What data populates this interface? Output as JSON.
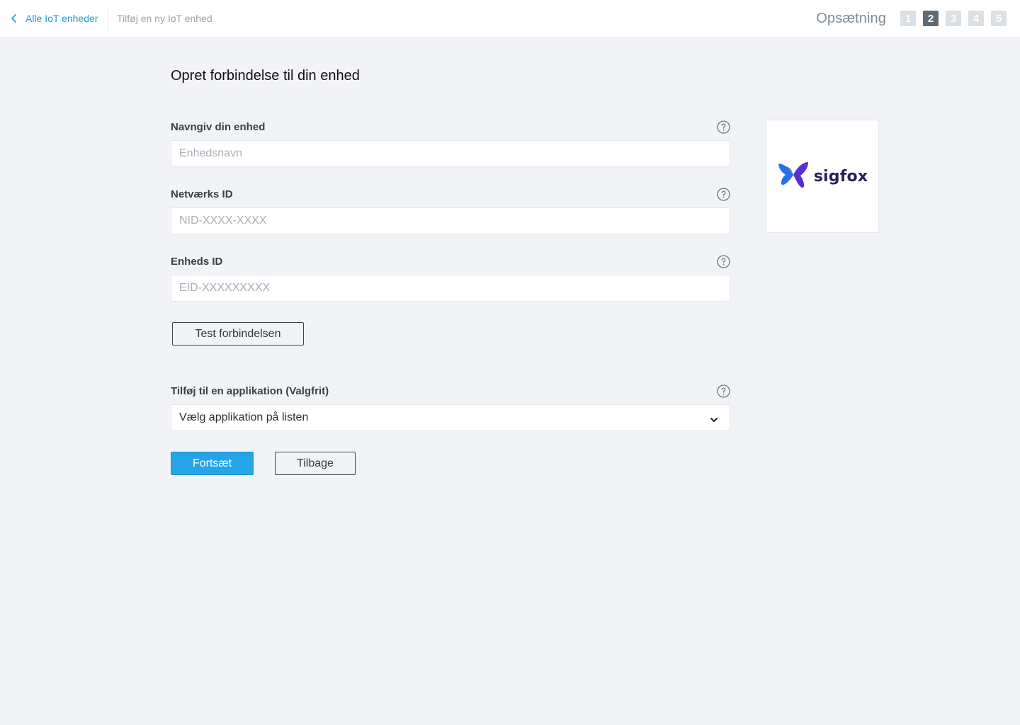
{
  "header": {
    "back_label": "Alle IoT enheder",
    "current_page": "Tilføj en ny IoT enhed",
    "steps_label": "Opsætning",
    "steps": [
      "1",
      "2",
      "3",
      "4",
      "5"
    ],
    "active_step": "2"
  },
  "main": {
    "title": "Opret forbindelse til din enhed",
    "fields": {
      "device_name": {
        "label": "Navngiv din enhed",
        "placeholder": "Enhedsnavn",
        "value": ""
      },
      "network_id": {
        "label": "Netværks ID",
        "placeholder": "NID-XXXX-XXXX",
        "value": ""
      },
      "device_id": {
        "label": "Enheds ID",
        "placeholder": "EID-XXXXXXXXX",
        "value": ""
      }
    },
    "test_button": "Test forbindelsen",
    "application": {
      "label": "Tilføj til en applikation (Valgfrit)",
      "selected": "Vælg applikation på listen"
    },
    "continue_button": "Fortsæt",
    "back_button": "Tilbage"
  },
  "provider": {
    "logo_text": "sigfox",
    "icon": "sigfox-butterfly-logo"
  },
  "colors": {
    "accent": "#26a4e6",
    "link": "#1f9bd8",
    "background": "#f1f3f7",
    "step_active": "#5e6b76",
    "step_inactive": "#dbe0e4",
    "logo_purple": "#5a2fd0",
    "logo_blue": "#2a6ef0",
    "logo_text": "#2a1e5c"
  },
  "icons": {
    "back": "chevron-left-icon",
    "help": "question-circle-icon",
    "dropdown": "chevron-down-icon"
  }
}
